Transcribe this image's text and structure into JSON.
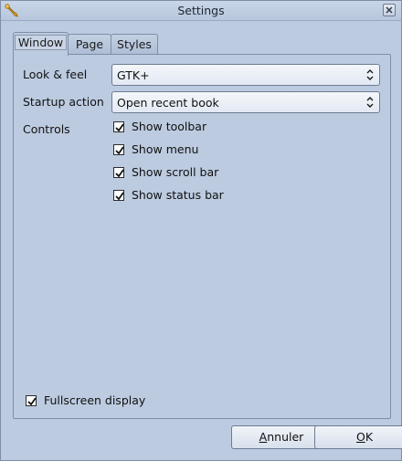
{
  "window": {
    "title": "Settings"
  },
  "tabs": [
    {
      "label": "Window",
      "active": true
    },
    {
      "label": "Page",
      "active": false
    },
    {
      "label": "Styles",
      "active": false
    }
  ],
  "look_and_feel": {
    "label": "Look & feel",
    "value": "GTK+"
  },
  "startup_action": {
    "label": "Startup action",
    "value": "Open recent book"
  },
  "controls": {
    "label": "Controls",
    "items": [
      {
        "label": "Show toolbar",
        "checked": true
      },
      {
        "label": "Show menu",
        "checked": true
      },
      {
        "label": "Show scroll bar",
        "checked": true
      },
      {
        "label": "Show status bar",
        "checked": true
      }
    ]
  },
  "fullscreen": {
    "label": "Fullscreen display",
    "checked": true
  },
  "buttons": {
    "cancel_first": "A",
    "cancel_rest": "nnuler",
    "ok_first": "O",
    "ok_rest": "K"
  }
}
